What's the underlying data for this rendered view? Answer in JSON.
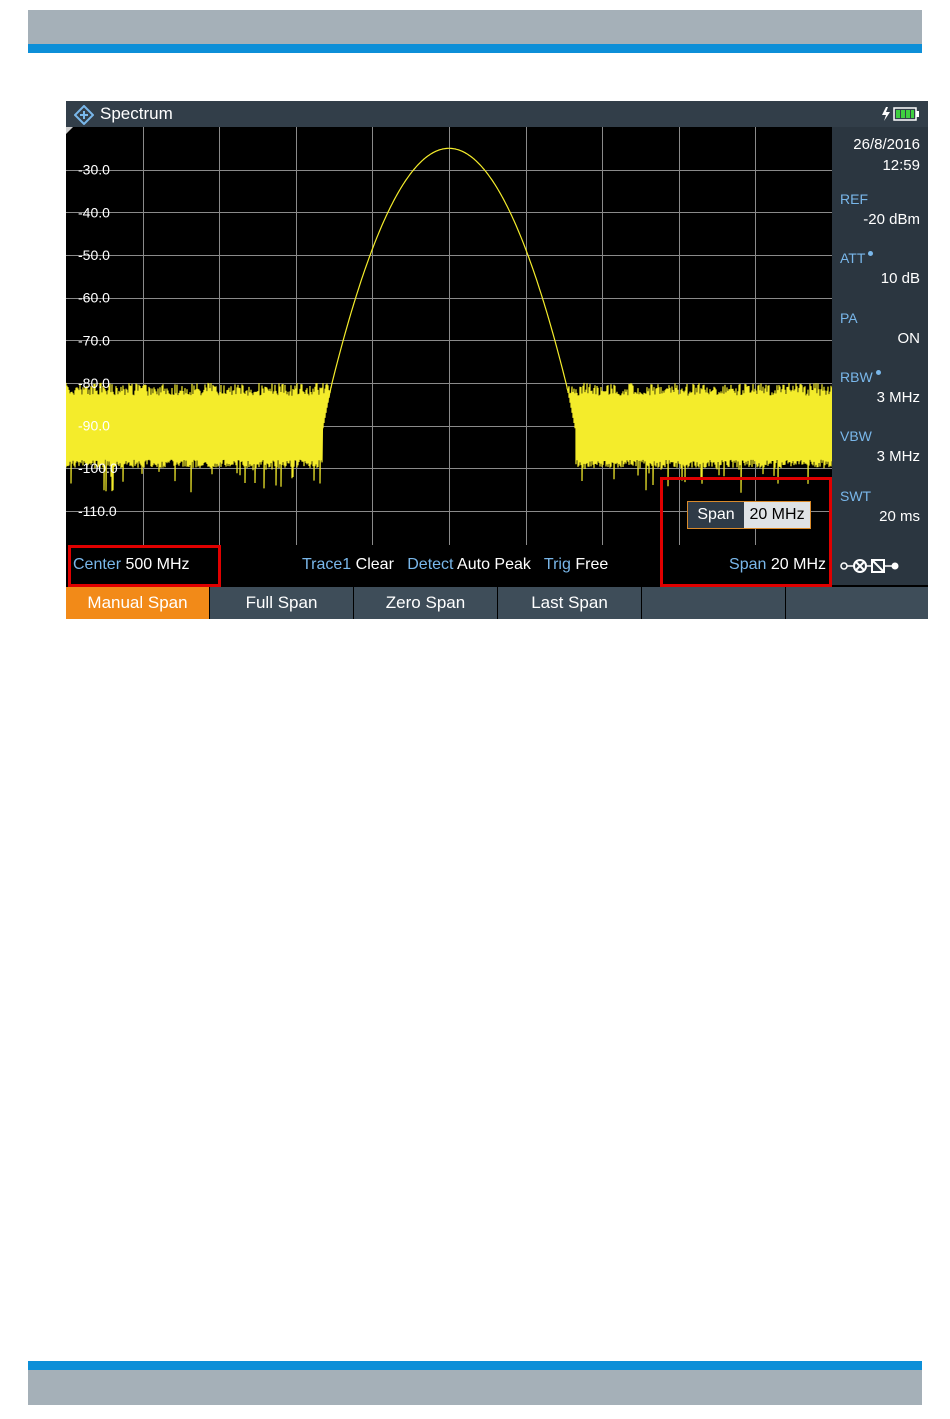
{
  "app": {
    "title": "Spectrum",
    "accent_color": "#f28a18",
    "label_color": "#79b7ea",
    "trace_color": "#f4ec2b"
  },
  "side_panel": {
    "date": "26/8/2016",
    "time": "12:59",
    "params": [
      {
        "label": "REF",
        "value": "-20 dBm"
      },
      {
        "label": "ATT",
        "value": "10 dB"
      },
      {
        "label": "PA",
        "value": "ON"
      },
      {
        "label": "RBW",
        "value": "3 MHz"
      },
      {
        "label": "VBW",
        "value": "3 MHz"
      },
      {
        "label": "SWT",
        "value": "20 ms"
      }
    ]
  },
  "status_bar": {
    "center_label": "Center",
    "center_value": "500 MHz",
    "trace_label": "Trace1",
    "trace_value": "Clear",
    "detect_label": "Detect",
    "detect_value": "Auto Peak",
    "trig_label": "Trig",
    "trig_value": "Free",
    "span_label": "Span",
    "span_value": "20 MHz"
  },
  "span_input": {
    "label": "Span",
    "value": "20 MHz"
  },
  "softkeys": [
    {
      "label": "Manual Span",
      "active": true
    },
    {
      "label": "Full Span",
      "active": false
    },
    {
      "label": "Zero Span",
      "active": false
    },
    {
      "label": "Last Span",
      "active": false
    },
    {
      "label": "",
      "active": false
    },
    {
      "label": "",
      "active": false
    }
  ],
  "chart_data": {
    "type": "line",
    "ylim": [
      -118,
      -20
    ],
    "y_tick_labels": [
      "-30.0",
      "-40.0",
      "-50.0",
      "-60.0",
      "-70.0",
      "-80.0",
      "-90.0",
      "-100.0",
      "-110.0"
    ],
    "y_ticks": [
      -30,
      -40,
      -50,
      -60,
      -70,
      -80,
      -90,
      -100,
      -110
    ],
    "x_divisions": 10,
    "grid": true,
    "center_frequency": "500 MHz",
    "span": "20 MHz",
    "series": [
      {
        "peak_level_dbm": -25,
        "noise_floor_band_dbm": [
          -98,
          -80
        ]
      }
    ]
  }
}
